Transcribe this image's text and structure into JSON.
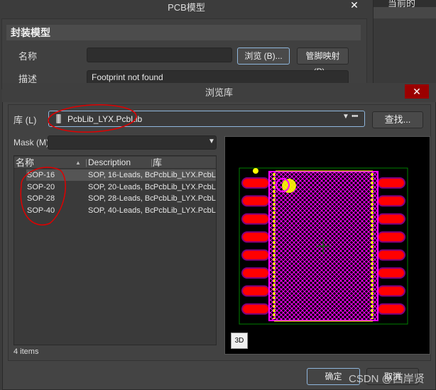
{
  "parent_dialog": {
    "title": "PCB模型",
    "close": "✕",
    "section": "封装模型",
    "name_label": "名称",
    "name_value": "",
    "browse_button": "浏览 (B)...",
    "pin_map_button": "管脚映射 (P)...",
    "desc_label": "描述",
    "desc_value": "Footprint not found"
  },
  "right_panel": {
    "header": "当前的"
  },
  "browse_dialog": {
    "title": "浏览库",
    "close": "✕",
    "lib_label": "库 (L)",
    "lib_value": "PcbLib_LYX.PcbLib",
    "lib_more": "•••",
    "find_button": "查找...",
    "mask_label": "Mask (M)",
    "mask_value": "",
    "columns": [
      "名称",
      "Description",
      "库"
    ],
    "rows": [
      {
        "name": "SOP-16",
        "desc": "SOP, 16-Leads, Bc",
        "lib": "PcbLib_LYX.PcbLib"
      },
      {
        "name": "SOP-20",
        "desc": "SOP, 20-Leads, Bc",
        "lib": "PcbLib_LYX.PcbLib"
      },
      {
        "name": "SOP-28",
        "desc": "SOP, 28-Leads, Bc",
        "lib": "PcbLib_LYX.PcbLib"
      },
      {
        "name": "SOP-40",
        "desc": "SOP, 40-Leads, Bc",
        "lib": "PcbLib_LYX.PcbLib"
      }
    ],
    "selected_row": 0,
    "count": "4 items",
    "view_3d": "3D",
    "ok_button": "确定",
    "cancel_button": "取消"
  },
  "watermark": "CSDN @西岸贤",
  "colors": {
    "pad": "#ff0000",
    "body": "#ff00ff",
    "silk": "#ffff00",
    "outline": "#008000",
    "annotation": "#e00000"
  }
}
